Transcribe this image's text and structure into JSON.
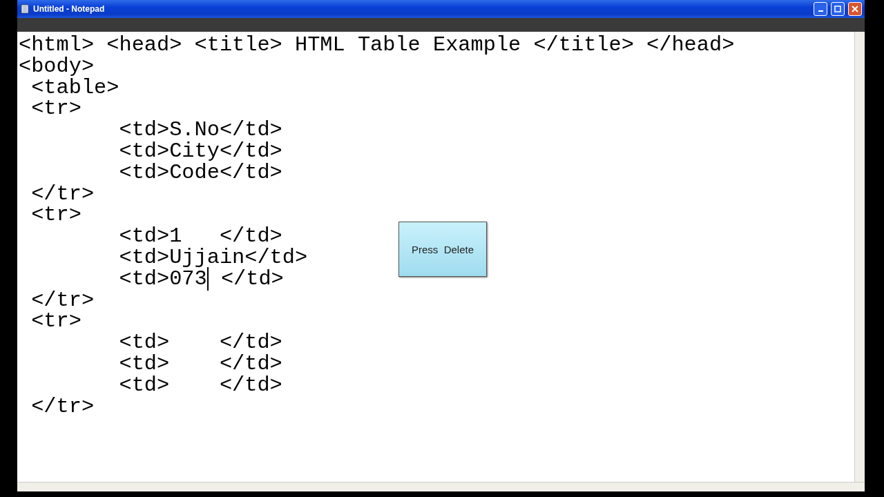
{
  "window": {
    "title": "Untitled - Notepad"
  },
  "editor": {
    "lines": [
      {
        "text": "<html> <head> <title> HTML Table Example </title> </head>"
      },
      {
        "text": "<body>"
      },
      {
        "text": " <table>"
      },
      {
        "text": " <tr>"
      },
      {
        "text": "        <td>S.No</td>"
      },
      {
        "text": "        <td>City</td>"
      },
      {
        "text": "        <td>Code</td>"
      },
      {
        "text": " </tr>"
      },
      {
        "text": " <tr>"
      },
      {
        "text": "        <td>1   </td>"
      },
      {
        "text": "        <td>Ujjain</td>"
      },
      {
        "text": "        <td>073",
        "after_caret": " </td>"
      },
      {
        "text": " </tr>"
      },
      {
        "text": " <tr>"
      },
      {
        "text": "        <td>    </td>"
      },
      {
        "text": "        <td>    </td>"
      },
      {
        "text": "        <td>    </td>"
      },
      {
        "text": " </tr>"
      }
    ]
  },
  "callout": {
    "text": "Press  Delete"
  }
}
